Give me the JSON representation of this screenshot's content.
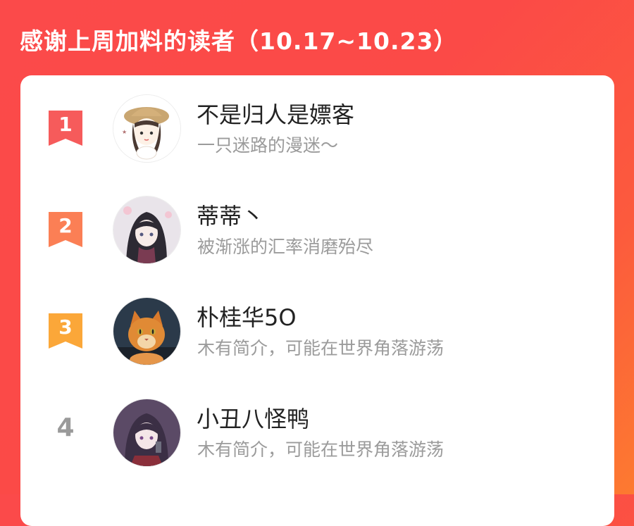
{
  "header": {
    "title": "感谢上周加料的读者（10.17~10.23）"
  },
  "colors": {
    "rank_1": "#f65b5b",
    "rank_2": "#fb7f55",
    "rank_3": "#fba739",
    "rank_plain": "#9a9a9a"
  },
  "readers": [
    {
      "rank": "1",
      "name": "不是归人是嫖客",
      "bio": "一只迷路的漫迷～",
      "avatar": "girl-with-hat-avatar"
    },
    {
      "rank": "2",
      "name": "蒂蒂丶",
      "bio": "被渐涨的汇率消磨殆尽",
      "avatar": "anime-girl-avatar"
    },
    {
      "rank": "3",
      "name": "朴桂华5O",
      "bio": "木有简介，可能在世界角落游荡",
      "avatar": "orange-cat-avatar"
    },
    {
      "rank": "4",
      "name": "小丑八怪鸭",
      "bio": "木有简介，可能在世界角落游荡",
      "avatar": "anime-girl-dark-avatar"
    }
  ]
}
